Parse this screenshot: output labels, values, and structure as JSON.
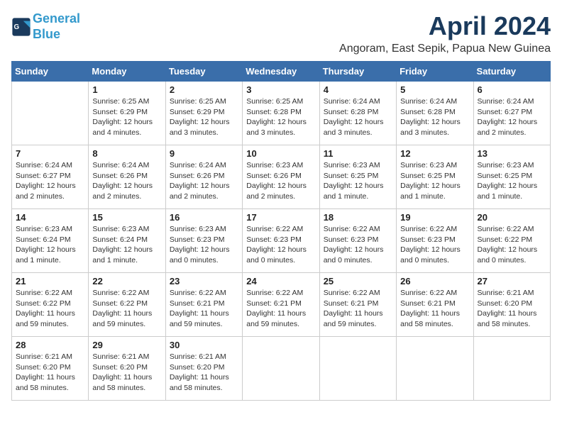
{
  "header": {
    "logo_line1": "General",
    "logo_line2": "Blue",
    "month_title": "April 2024",
    "location": "Angoram, East Sepik, Papua New Guinea"
  },
  "weekdays": [
    "Sunday",
    "Monday",
    "Tuesday",
    "Wednesday",
    "Thursday",
    "Friday",
    "Saturday"
  ],
  "weeks": [
    [
      {
        "day": "",
        "info": ""
      },
      {
        "day": "1",
        "info": "Sunrise: 6:25 AM\nSunset: 6:29 PM\nDaylight: 12 hours\nand 4 minutes."
      },
      {
        "day": "2",
        "info": "Sunrise: 6:25 AM\nSunset: 6:29 PM\nDaylight: 12 hours\nand 3 minutes."
      },
      {
        "day": "3",
        "info": "Sunrise: 6:25 AM\nSunset: 6:28 PM\nDaylight: 12 hours\nand 3 minutes."
      },
      {
        "day": "4",
        "info": "Sunrise: 6:24 AM\nSunset: 6:28 PM\nDaylight: 12 hours\nand 3 minutes."
      },
      {
        "day": "5",
        "info": "Sunrise: 6:24 AM\nSunset: 6:28 PM\nDaylight: 12 hours\nand 3 minutes."
      },
      {
        "day": "6",
        "info": "Sunrise: 6:24 AM\nSunset: 6:27 PM\nDaylight: 12 hours\nand 2 minutes."
      }
    ],
    [
      {
        "day": "7",
        "info": "Sunrise: 6:24 AM\nSunset: 6:27 PM\nDaylight: 12 hours\nand 2 minutes."
      },
      {
        "day": "8",
        "info": "Sunrise: 6:24 AM\nSunset: 6:26 PM\nDaylight: 12 hours\nand 2 minutes."
      },
      {
        "day": "9",
        "info": "Sunrise: 6:24 AM\nSunset: 6:26 PM\nDaylight: 12 hours\nand 2 minutes."
      },
      {
        "day": "10",
        "info": "Sunrise: 6:23 AM\nSunset: 6:26 PM\nDaylight: 12 hours\nand 2 minutes."
      },
      {
        "day": "11",
        "info": "Sunrise: 6:23 AM\nSunset: 6:25 PM\nDaylight: 12 hours\nand 1 minute."
      },
      {
        "day": "12",
        "info": "Sunrise: 6:23 AM\nSunset: 6:25 PM\nDaylight: 12 hours\nand 1 minute."
      },
      {
        "day": "13",
        "info": "Sunrise: 6:23 AM\nSunset: 6:25 PM\nDaylight: 12 hours\nand 1 minute."
      }
    ],
    [
      {
        "day": "14",
        "info": "Sunrise: 6:23 AM\nSunset: 6:24 PM\nDaylight: 12 hours\nand 1 minute."
      },
      {
        "day": "15",
        "info": "Sunrise: 6:23 AM\nSunset: 6:24 PM\nDaylight: 12 hours\nand 1 minute."
      },
      {
        "day": "16",
        "info": "Sunrise: 6:23 AM\nSunset: 6:23 PM\nDaylight: 12 hours\nand 0 minutes."
      },
      {
        "day": "17",
        "info": "Sunrise: 6:22 AM\nSunset: 6:23 PM\nDaylight: 12 hours\nand 0 minutes."
      },
      {
        "day": "18",
        "info": "Sunrise: 6:22 AM\nSunset: 6:23 PM\nDaylight: 12 hours\nand 0 minutes."
      },
      {
        "day": "19",
        "info": "Sunrise: 6:22 AM\nSunset: 6:23 PM\nDaylight: 12 hours\nand 0 minutes."
      },
      {
        "day": "20",
        "info": "Sunrise: 6:22 AM\nSunset: 6:22 PM\nDaylight: 12 hours\nand 0 minutes."
      }
    ],
    [
      {
        "day": "21",
        "info": "Sunrise: 6:22 AM\nSunset: 6:22 PM\nDaylight: 11 hours\nand 59 minutes."
      },
      {
        "day": "22",
        "info": "Sunrise: 6:22 AM\nSunset: 6:22 PM\nDaylight: 11 hours\nand 59 minutes."
      },
      {
        "day": "23",
        "info": "Sunrise: 6:22 AM\nSunset: 6:21 PM\nDaylight: 11 hours\nand 59 minutes."
      },
      {
        "day": "24",
        "info": "Sunrise: 6:22 AM\nSunset: 6:21 PM\nDaylight: 11 hours\nand 59 minutes."
      },
      {
        "day": "25",
        "info": "Sunrise: 6:22 AM\nSunset: 6:21 PM\nDaylight: 11 hours\nand 59 minutes."
      },
      {
        "day": "26",
        "info": "Sunrise: 6:22 AM\nSunset: 6:21 PM\nDaylight: 11 hours\nand 58 minutes."
      },
      {
        "day": "27",
        "info": "Sunrise: 6:21 AM\nSunset: 6:20 PM\nDaylight: 11 hours\nand 58 minutes."
      }
    ],
    [
      {
        "day": "28",
        "info": "Sunrise: 6:21 AM\nSunset: 6:20 PM\nDaylight: 11 hours\nand 58 minutes."
      },
      {
        "day": "29",
        "info": "Sunrise: 6:21 AM\nSunset: 6:20 PM\nDaylight: 11 hours\nand 58 minutes."
      },
      {
        "day": "30",
        "info": "Sunrise: 6:21 AM\nSunset: 6:20 PM\nDaylight: 11 hours\nand 58 minutes."
      },
      {
        "day": "",
        "info": ""
      },
      {
        "day": "",
        "info": ""
      },
      {
        "day": "",
        "info": ""
      },
      {
        "day": "",
        "info": ""
      }
    ]
  ]
}
